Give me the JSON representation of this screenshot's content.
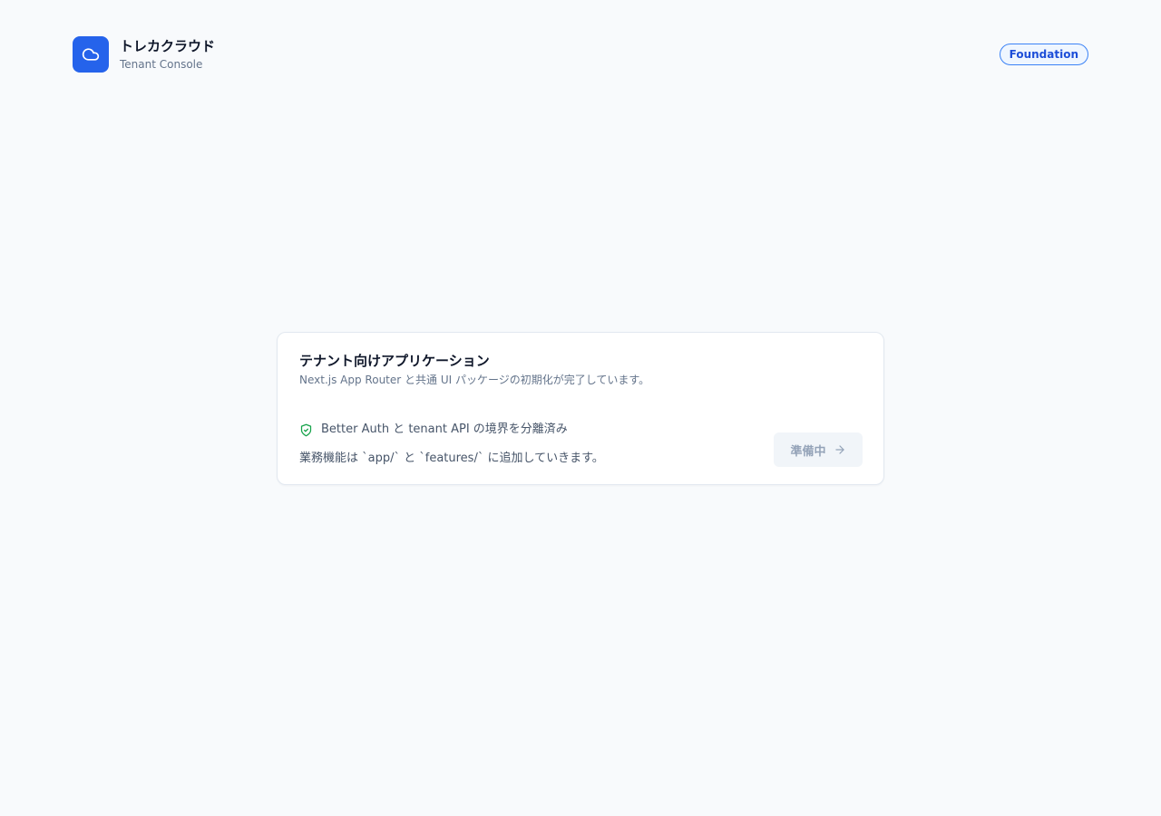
{
  "header": {
    "brand_name": "トレカクラウド",
    "brand_subtitle": "Tenant Console",
    "logo_icon": "cloud-icon",
    "badge": "Foundation"
  },
  "card": {
    "title": "テナント向けアプリケーション",
    "description": "Next.js App Router と共通 UI パッケージの初期化が完了しています。",
    "status_icon": "shield-check-icon",
    "status_text": "Better Auth と tenant API の境界を分離済み",
    "note": "業務機能は `app/` と `features/` に追加していきます。",
    "button_label": "準備中",
    "button_icon": "arrow-right-icon"
  },
  "colors": {
    "background": "#f8fafc",
    "accent": "#2563eb",
    "success": "#16a34a",
    "muted_text": "#64748b"
  }
}
